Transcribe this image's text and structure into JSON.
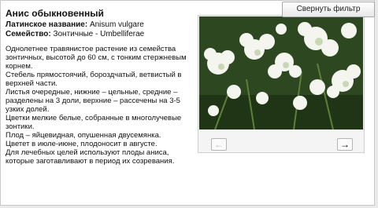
{
  "toolbar": {
    "collapse_label": "Свернуть фильтр"
  },
  "plant": {
    "title": "Анис обыкновенный",
    "latin_label": "Латинское название:",
    "latin_value": "Anisum vulgare",
    "family_label": "Семейство:",
    "family_value": "Зонтичные - Umbelliferae",
    "description": [
      "Однолетнее травянистое растение из семейства зонтичных, высотой до 60 см, с тонким стержневым корнем.",
      "Стебель прямостоячий, бороздчатый, ветвистый в верхней части.",
      "Листья очередные, нижние – цельные, средние – разделены на 3 доли, верхние – рассечены на 3-5 узких долей.",
      "Цветки мелкие белые, собранные в многолучевые зонтики.",
      "Плод – яйцевидная, опушенная двусемянка.",
      "Цветет в июле-июне, плодоносит в августе.",
      "Для лечебных целей используют плоды аниса, которые заготавливают в период их созревания."
    ]
  },
  "gallery": {
    "prev_icon": "arrow-left-icon",
    "next_icon": "arrow-right-icon"
  }
}
